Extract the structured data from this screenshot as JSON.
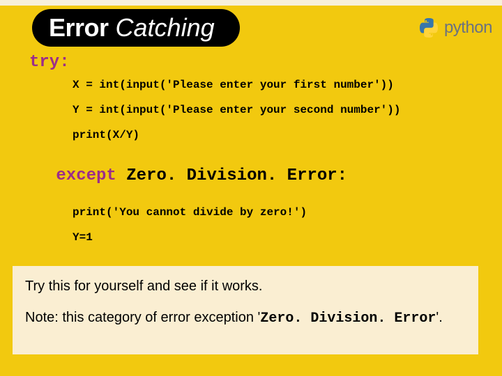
{
  "header": {
    "title_bold": "Error",
    "title_italic": " Catching",
    "logo_text": "python"
  },
  "code": {
    "try_kw": "try:",
    "line_x": "X = int(input('Please enter your first number'))",
    "line_y": "Y = int(input('Please enter your second number'))",
    "line_print": "print(X/Y)",
    "except_kw": "except ",
    "except_ident": "Zero. Division. Error: ",
    "line_except_print": "print('You cannot divide by zero!')",
    "line_y1": "Y=1"
  },
  "note": {
    "p1": "Try this for yourself and see if it works.",
    "p2a": "Note: this category of error exception '",
    "p2b": "Zero. Division. Error",
    "p2c": "'."
  }
}
